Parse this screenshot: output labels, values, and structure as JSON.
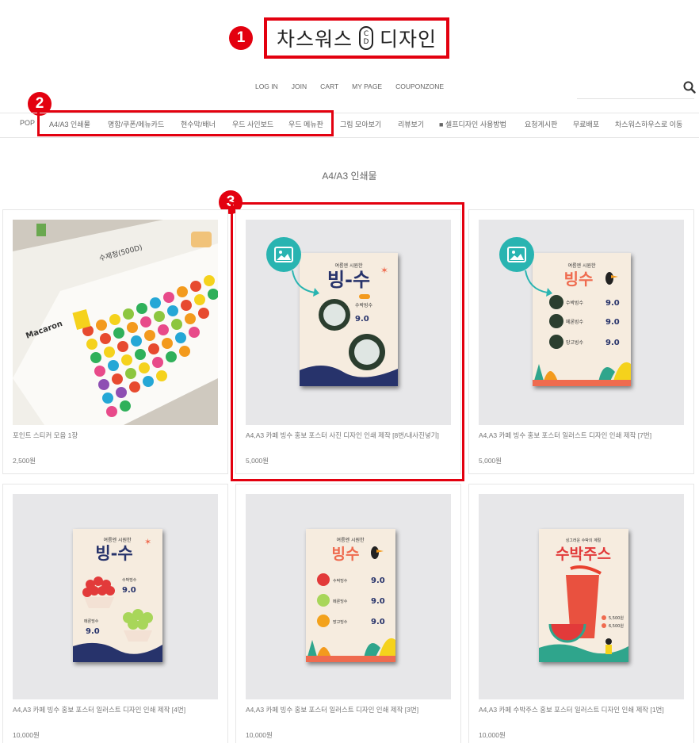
{
  "logo": {
    "text_left": "차스워스",
    "mark_top": "C",
    "mark_bottom": "D",
    "text_right": "디자인"
  },
  "annotations": [
    "1",
    "2",
    "3"
  ],
  "top_links": [
    "LOG IN",
    "JOIN",
    "CART",
    "MY PAGE",
    "COUPONZONE"
  ],
  "nav": [
    "POP",
    "A4/A3 인쇄물",
    "명함/쿠폰/메뉴카드",
    "현수막/배너",
    "우드 사인보드",
    "우드 메뉴판",
    "그림 모아보기",
    "리뷰보기",
    "■ 셀프디자인 사용방법",
    "요청게시판",
    "무료배포",
    "차스워스하우스로 이동"
  ],
  "section_title": "A4/A3 인쇄물",
  "products": [
    {
      "name": "포인트 스티커 모음 1장",
      "price": "2,500원"
    },
    {
      "name": "A4,A3 카페 빙수 홍보 포스터 사진 디자인 인쇄 제작 [8번/내사진넣기]",
      "price": "5,000원"
    },
    {
      "name": "A4,A3 카페 빙수 홍보 포스터 일러스트 디자인 인쇄 제작 [7번]",
      "price": "5,000원"
    },
    {
      "name": "A4,A3 카페 빙수 홍보 포스터 일러스트 디자인 인쇄 제작 [4번]",
      "price": "10,000원"
    },
    {
      "name": "A4,A3 카페 빙수 홍보 포스터 일러스트 디자인 인쇄 제작 [3번]",
      "price": "10,000원"
    },
    {
      "name": "A4,A3 카페 수박주스 홍보 포스터 일러스트 디자인 인쇄 제작 [1번]",
      "price": "10,000원"
    }
  ],
  "posters": {
    "bingsu_tagline": "여름엔 시원한",
    "bingsu_title": "빙-수",
    "bingsu_title2": "빙수",
    "price": "9.0",
    "menu_items": [
      "수박빙수",
      "메론빙수",
      "망고빙수"
    ],
    "juice_tagline": "싱그러운 수박의 계절",
    "juice_title": "수박주스",
    "juice_prices": [
      "5,500원",
      "6,500원"
    ],
    "sticker_label": "수제청(500D)",
    "sticker_macaron": "Macaron"
  },
  "colors": {
    "accent_red": "#e3000f",
    "photo_icon": "#29b4b1",
    "poster_bg": "#f6ecdf",
    "poster_navy": "#27336b"
  }
}
